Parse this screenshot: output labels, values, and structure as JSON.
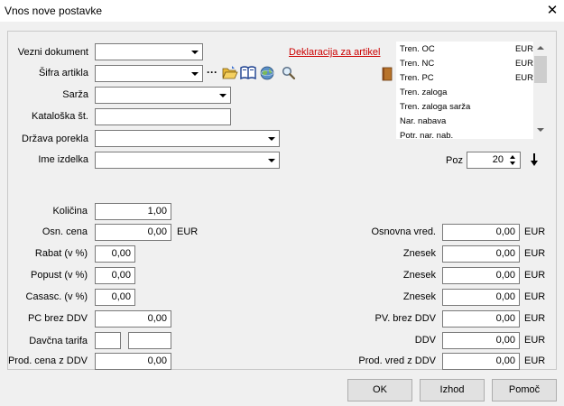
{
  "window": {
    "title": "Vnos nove postavke"
  },
  "header": {
    "vezni_dokument": {
      "label": "Vezni dokument",
      "value": ""
    },
    "deklaracija_link": "Deklaracija za artikel",
    "sifra_artikla": {
      "label": "Šifra artikla",
      "value": "",
      "ellipsis": "···"
    },
    "sarza": {
      "label": "Sarža",
      "value": ""
    },
    "kataloska": {
      "label": "Kataloška št.",
      "value": ""
    },
    "drzava": {
      "label": "Država porekla",
      "value": ""
    },
    "ime_izdelka": {
      "label": "Ime izdelka",
      "value": ""
    },
    "poz": {
      "label": "Poz",
      "value": "20"
    }
  },
  "side_list": [
    {
      "label": "Tren. OC",
      "unit": "EUR"
    },
    {
      "label": "Tren. NC",
      "unit": "EUR"
    },
    {
      "label": "Tren. PC",
      "unit": "EUR"
    },
    {
      "label": "Tren. zaloga",
      "unit": ""
    },
    {
      "label": "Tren. zaloga sarža",
      "unit": ""
    },
    {
      "label": "Nar. nabava",
      "unit": ""
    },
    {
      "label": "Potr. nar. nab.",
      "unit": ""
    }
  ],
  "left_fields": {
    "kolicina": {
      "label": "Količina",
      "value": "1,00"
    },
    "osn_cena": {
      "label": "Osn. cena",
      "value": "0,00",
      "unit": "EUR"
    },
    "rabat": {
      "label": "Rabat (v %)",
      "value": "0,00"
    },
    "popust": {
      "label": "Popust (v %)",
      "value": "0,00"
    },
    "casasc": {
      "label": "Casasc. (v %)",
      "value": "0,00"
    },
    "pc_brez_ddv": {
      "label": "PC brez DDV",
      "value": "0,00"
    },
    "davcna_tarifa": {
      "label": "Davčna tarifa",
      "code": "",
      "name": ""
    },
    "prod_cena_z_ddv": {
      "label": "Prod. cena z DDV",
      "value": "0,00"
    }
  },
  "right_fields": {
    "osnovna_vred": {
      "label": "Osnovna vred.",
      "value": "0,00",
      "unit": "EUR"
    },
    "znesek1": {
      "label": "Znesek",
      "value": "0,00",
      "unit": "EUR"
    },
    "znesek2": {
      "label": "Znesek",
      "value": "0,00",
      "unit": "EUR"
    },
    "znesek3": {
      "label": "Znesek",
      "value": "0,00",
      "unit": "EUR"
    },
    "pv_brez_ddv": {
      "label": "PV. brez DDV",
      "value": "0,00",
      "unit": "EUR"
    },
    "ddv": {
      "label": "DDV",
      "value": "0,00",
      "unit": "EUR"
    },
    "prod_vred_z_ddv": {
      "label": "Prod. vred z DDV",
      "value": "0,00",
      "unit": "EUR"
    }
  },
  "buttons": {
    "ok": "OK",
    "izhod": "Izhod",
    "pomoc": "Pomoč"
  },
  "icons": [
    "folder-open-icon",
    "book-icon",
    "globe-icon",
    "magnifier-icon",
    "notebook-icon",
    "arrow-down-icon"
  ]
}
